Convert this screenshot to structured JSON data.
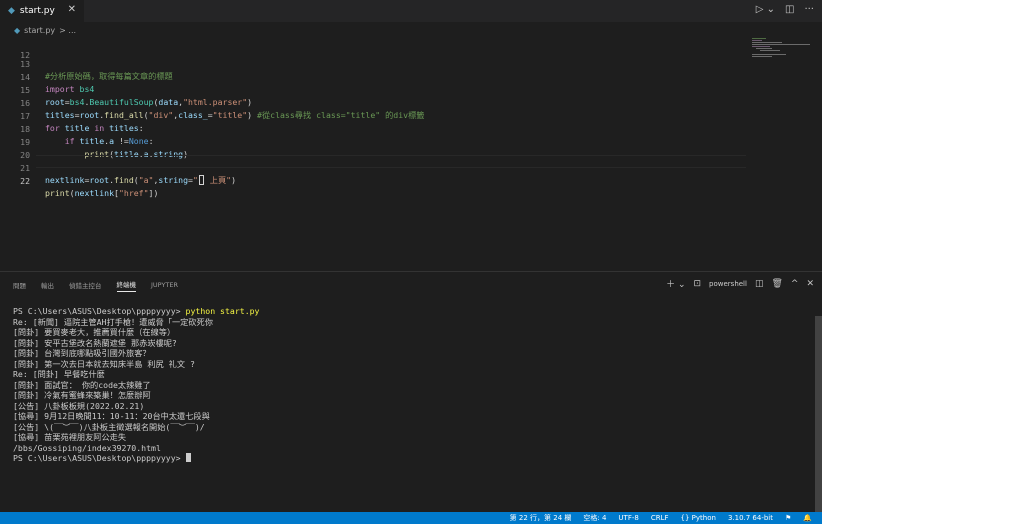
{
  "editor": {
    "tab_name": "start.py",
    "breadcrumb_file": "start.py",
    "breadcrumb_sep": "> ...",
    "lines": [
      {
        "num": "12",
        "text": ""
      },
      {
        "num": "13",
        "text": "#分析原始碼，取得每篇文章的標題"
      },
      {
        "num": "14",
        "text": "import bs4"
      },
      {
        "num": "15",
        "text": "root=bs4.BeautifulSoup(data,\"html.parser\")"
      },
      {
        "num": "16",
        "text": "titles=root.find_all(\"div\",class_=\"title\") #從class尋找 class=\"title\" 的div標籤"
      },
      {
        "num": "17",
        "text": "for title in titles:"
      },
      {
        "num": "18",
        "text": "    if title.a !=None:"
      },
      {
        "num": "19",
        "text": "        print(title.a.string)"
      },
      {
        "num": "20",
        "text": ""
      },
      {
        "num": "21",
        "text": "nextlink=root.find(\"a\",string=\"‹ 上頁\")"
      },
      {
        "num": "22",
        "text": "print(nextlink[\"href\"])"
      }
    ]
  },
  "panel": {
    "tabs": [
      "問題",
      "輸出",
      "偵錯主控台",
      "終端機",
      "JUPYTER"
    ],
    "active_tab": "終端機",
    "shell": "powershell",
    "prompt": "PS C:\\Users\\ASUS\\Desktop\\ppppyyyy>",
    "command": "python start.py",
    "output": [
      "Re: [新聞] 逼院主管AH打手槍！遭威脅「一定砍死你",
      "[問卦] 要買麥老大，推薦買什麼（在線等）",
      "[問卦] 安平古堡改名熱蘭遮堡 那赤崁樓呢?",
      "[問卦] 台灣到底哪點吸引國外旅客？",
      "[問卦] 第一次去日本就去知床半島 利尻 礼文 ?",
      "Re: [問卦] 早餐吃什麼",
      "[問卦] 面試官： 你的code太辣雞了",
      "[問卦] 冷氣有蜜蜂來築巢！怎麼辦阿",
      "[公告] 八卦板板規(2022.02.21)",
      "[協尋] 9月12日晚間11：10-11：20台中太還七段與",
      "[公告] \\(￣︶￣)八卦板主徵選報名開始(￣︶￣)/",
      "[協尋] 苗栗苑裡朋友阿公走失",
      "/bbs/Gossiping/index39270.html"
    ],
    "final_prompt": "PS C:\\Users\\ASUS\\Desktop\\ppppyyyy>"
  },
  "statusbar": {
    "position": "第 22 行，第 24 欄",
    "spaces": "空格: 4",
    "encoding": "UTF-8",
    "eol": "CRLF",
    "language": "Python",
    "interpreter": "3.10.7 64-bit"
  },
  "icons": {
    "file": "python-file-icon",
    "close": "close-icon",
    "run": "run-icon",
    "split": "split-editor-icon",
    "more": "more-actions-icon"
  }
}
